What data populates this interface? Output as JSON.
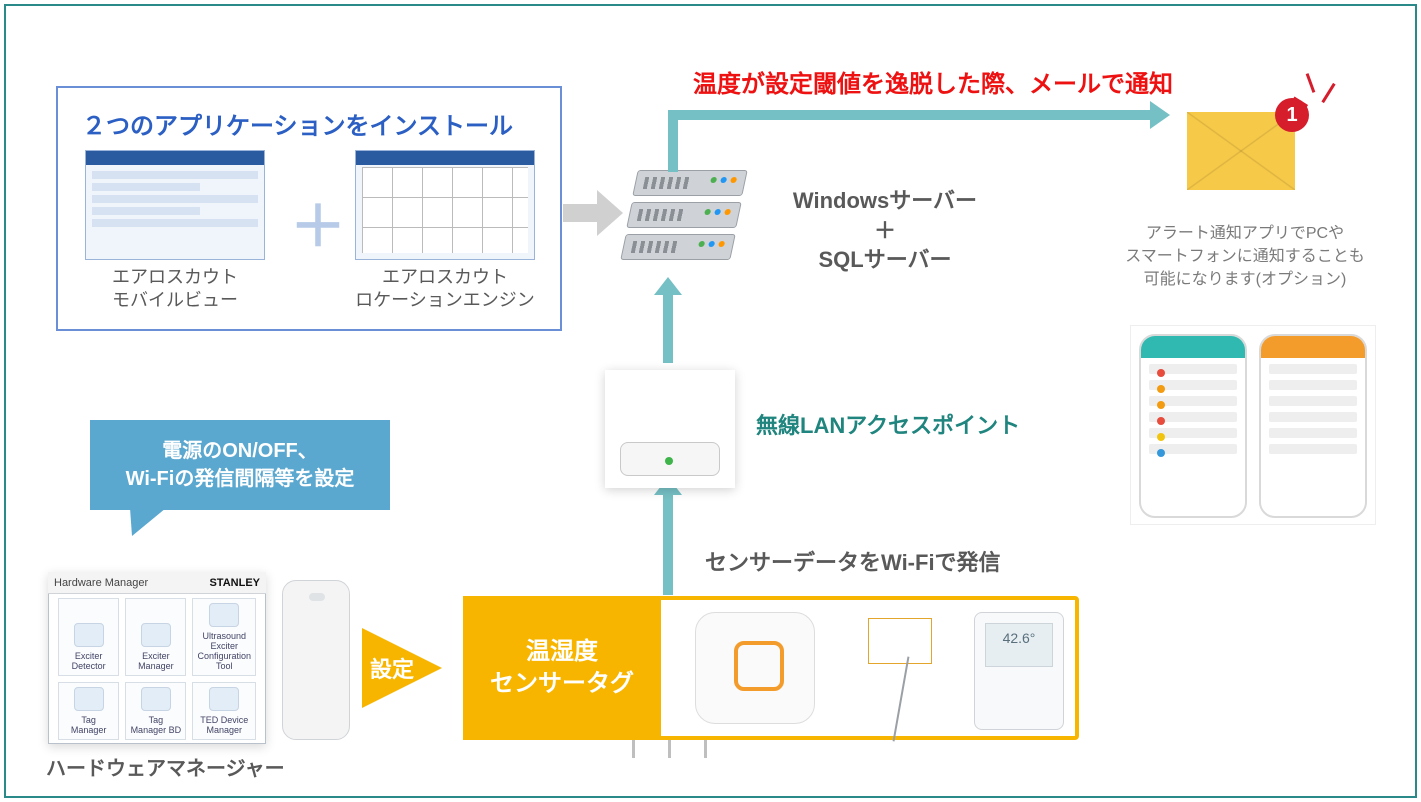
{
  "alert_headline": "温度が設定閾値を逸脱した際、メールで通知",
  "apps": {
    "title": "２つのアプリケーションをインストール",
    "plus": "＋",
    "a_caption_l1": "エアロスカウト",
    "a_caption_l2": "モバイルビュー",
    "b_caption_l1": "エアロスカウト",
    "b_caption_l2": "ロケーションエンジン"
  },
  "server": {
    "line1": "Windowsサーバー",
    "line2": "＋",
    "line3": "SQLサーバー"
  },
  "mail": {
    "badge": "1",
    "caption_l1": "アラート通知アプリでPCや",
    "caption_l2": "スマートフォンに通知することも",
    "caption_l3": "可能になります(オプション)"
  },
  "ap": {
    "label": "無線LANアクセスポイント"
  },
  "wifi_caption": "センサーデータをWi-Fiで発信",
  "sensor_tag": {
    "label_l1": "温湿度",
    "label_l2": "センサータグ",
    "lcd_value": "42.6°"
  },
  "set_arrow_label": "設定",
  "bubble": {
    "l1": "電源のON/OFF、",
    "l2": "Wi-Fiの発信間隔等を設定"
  },
  "hw": {
    "titlebar_left": "Hardware Manager",
    "brand": "STANLEY",
    "cells": [
      "Exciter Detector",
      "Exciter Manager",
      "Ultrasound Exciter Configuration Tool",
      "Tag Manager",
      "Tag Manager BD",
      "TED Device Manager"
    ],
    "caption": "ハードウェアマネージャー"
  }
}
